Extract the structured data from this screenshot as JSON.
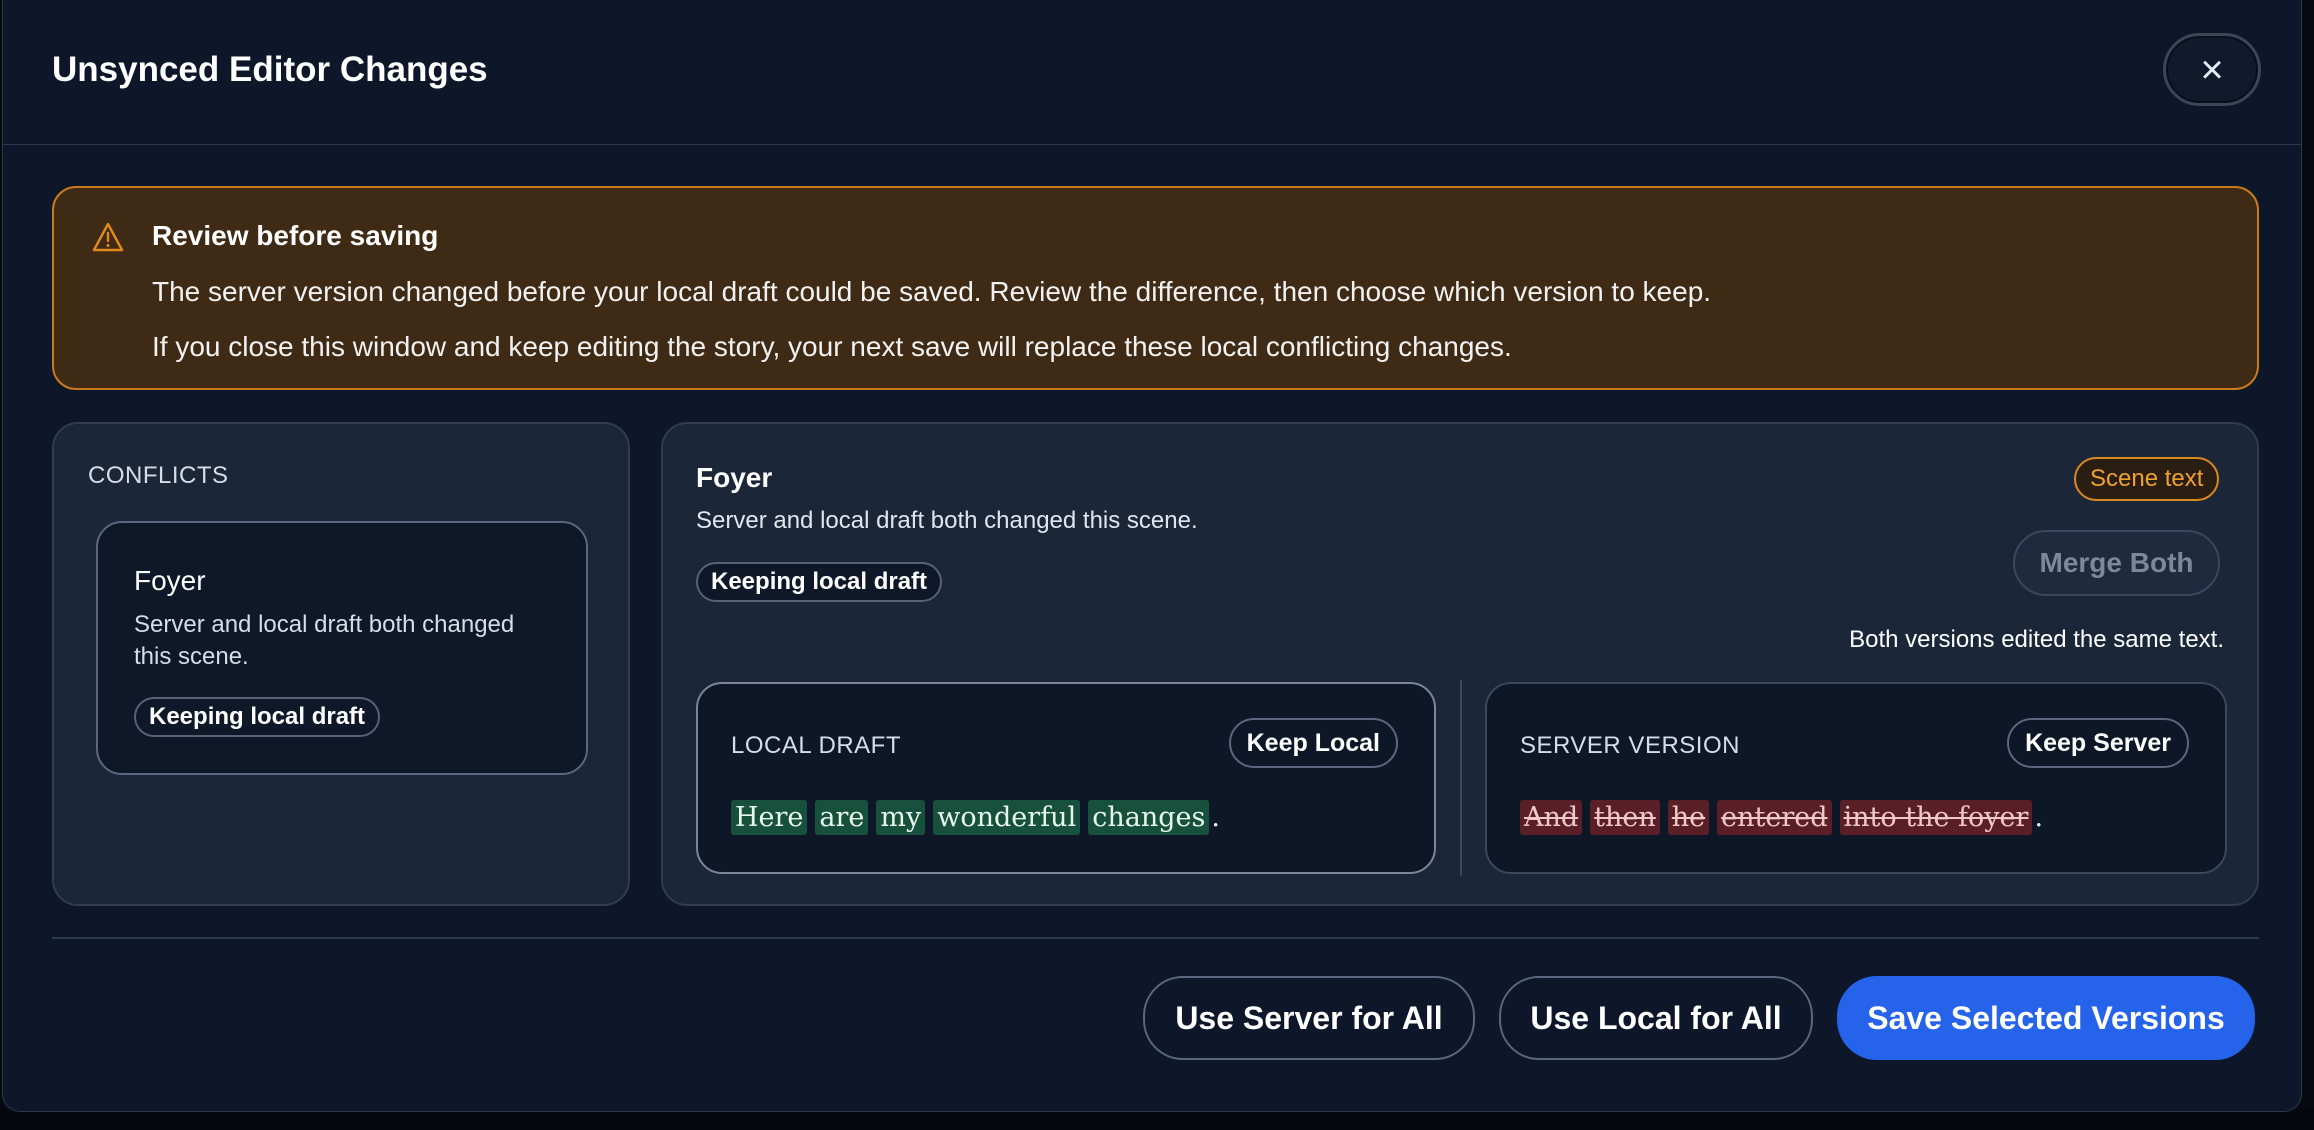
{
  "modal": {
    "title": "Unsynced Editor Changes",
    "close_icon": "×"
  },
  "warning": {
    "icon": "warning-triangle-icon",
    "title": "Review before saving",
    "line1": "The server version changed before your local draft could be saved. Review the difference, then choose which version to keep.",
    "line2": "If you close this window and keep editing the story, your next save will replace these local conflicting changes.",
    "colors": {
      "background": "#3f2b15",
      "border": "#c97a1a"
    }
  },
  "conflicts": {
    "heading": "CONFLICTS",
    "items": [
      {
        "title": "Foyer",
        "description": "Server and local draft both changed this scene.",
        "status": "Keeping local draft"
      }
    ]
  },
  "detail": {
    "title": "Foyer",
    "description": "Server and local draft both changed this scene.",
    "status": "Keeping local draft",
    "badge": "Scene text",
    "merge_label": "Merge Both",
    "note": "Both versions edited the same text.",
    "local": {
      "label": "LOCAL DRAFT",
      "button": "Keep Local",
      "tokens": [
        "Here",
        "are",
        "my",
        "wonderful",
        "changes"
      ],
      "suffix": "."
    },
    "server": {
      "label": "SERVER VERSION",
      "button": "Keep Server",
      "tokens": [
        "And",
        "then",
        "he",
        "entered",
        "into the foyer"
      ],
      "suffix": "."
    }
  },
  "footer": {
    "use_server_all": "Use Server for All",
    "use_local_all": "Use Local for All",
    "save_selected": "Save Selected Versions",
    "primary_color": "#2563eb"
  }
}
